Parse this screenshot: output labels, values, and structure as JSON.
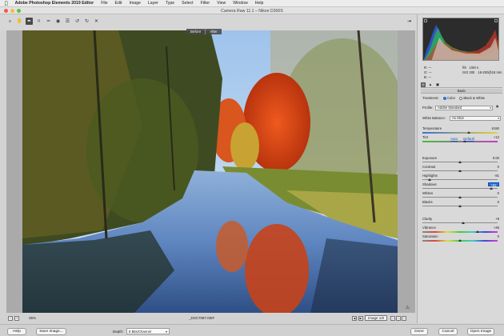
{
  "menubar": {
    "apple_icon": "",
    "app_name": "Adobe Photoshop Elements 2019 Editor",
    "items": [
      "File",
      "Edit",
      "Image",
      "Layer",
      "Type",
      "Select",
      "Filter",
      "View",
      "Window",
      "Help"
    ]
  },
  "window": {
    "title": "Camera Raw 11.1  –  Nikon D300S"
  },
  "toolbar": {
    "tools": [
      {
        "icon": "zoom-icon",
        "glyph": "⌕"
      },
      {
        "icon": "hand-icon",
        "glyph": "✋"
      },
      {
        "icon": "white-balance-icon",
        "glyph": "✒",
        "active": true
      },
      {
        "icon": "crop-icon",
        "glyph": "⌑"
      },
      {
        "icon": "straighten-icon",
        "glyph": "━"
      },
      {
        "icon": "red-eye-icon",
        "glyph": "◉"
      },
      {
        "icon": "preferences-icon",
        "glyph": "☰"
      },
      {
        "icon": "rotate-left-icon",
        "glyph": "↺"
      },
      {
        "icon": "rotate-right-icon",
        "glyph": "↻"
      },
      {
        "icon": "delete-icon",
        "glyph": "✕"
      }
    ],
    "export_glyph": "⇥"
  },
  "preview": {
    "before_label": "Before",
    "after_label": "After",
    "warning_glyph": "⚠"
  },
  "status": {
    "zoom_out": "−",
    "zoom_in": "+",
    "zoom": "35%",
    "filename": "_DSC7087.NEF",
    "image_label": "Image 1/8",
    "prev": "◀",
    "next": "▶",
    "rating_icons": [
      "☆",
      "☆",
      "☆"
    ]
  },
  "bottom": {
    "help_label": "Help",
    "save_label": "Save Image...",
    "depth_label": "Depth:",
    "depth_value": "8 Bits/Channel",
    "done_label": "Done",
    "cancel_label": "Cancel",
    "open_label": "Open Image"
  },
  "panel": {
    "rgb": {
      "r_label": "R:",
      "r_value": "---",
      "g_label": "G:",
      "g_value": "---",
      "b_label": "B:",
      "b_value": "---",
      "aperture": "f/8",
      "shutter": "1/60 s",
      "iso": "ISO 200",
      "lens": "18-200@18 mm"
    },
    "tabs": [
      {
        "name": "basic-tab-icon",
        "glyph": "◎",
        "active": true
      },
      {
        "name": "detail-tab-icon",
        "glyph": "▲"
      },
      {
        "name": "camera-calibration-tab-icon",
        "glyph": "▣"
      }
    ],
    "section_title": "Basic",
    "treatment_label": "Treatment:",
    "color_label": "Color",
    "bw_label": "Black & White",
    "profile_label": "Profile:",
    "profile_value": "Adobe Standard",
    "wb_label": "White Balance:",
    "wb_value": "As Shot",
    "auto_label": "Auto",
    "default_label": "Default",
    "sliders": [
      {
        "key": "temperature",
        "label": "Temperature",
        "value": "6150",
        "pos": 0.62
      },
      {
        "key": "tint",
        "label": "Tint",
        "value": "+12",
        "pos": 0.56
      },
      {
        "key": "exposure",
        "label": "Exposure",
        "value": "0.00",
        "pos": 0.5
      },
      {
        "key": "contrast",
        "label": "Contrast",
        "value": "0",
        "pos": 0.5
      },
      {
        "key": "highlights",
        "label": "Highlights",
        "value": "-81",
        "pos": 0.1
      },
      {
        "key": "shadows",
        "label": "Shadows",
        "value": "+82",
        "pos": 0.91,
        "highlight": true
      },
      {
        "key": "whites",
        "label": "Whites",
        "value": "0",
        "pos": 0.5
      },
      {
        "key": "blacks",
        "label": "Blacks",
        "value": "0",
        "pos": 0.5
      },
      {
        "key": "clarity",
        "label": "Clarity",
        "value": "+8",
        "pos": 0.54
      },
      {
        "key": "vibrance",
        "label": "Vibrance",
        "value": "+46",
        "pos": 0.73
      },
      {
        "key": "saturation",
        "label": "Saturation",
        "value": "0",
        "pos": 0.5
      }
    ]
  },
  "colors": {
    "highlight": "#2a6ed8",
    "temp_gradient": [
      "#3b6fd6",
      "#e6d23a"
    ],
    "tint_gradient": [
      "#44c03a",
      "#c33bc8"
    ]
  }
}
